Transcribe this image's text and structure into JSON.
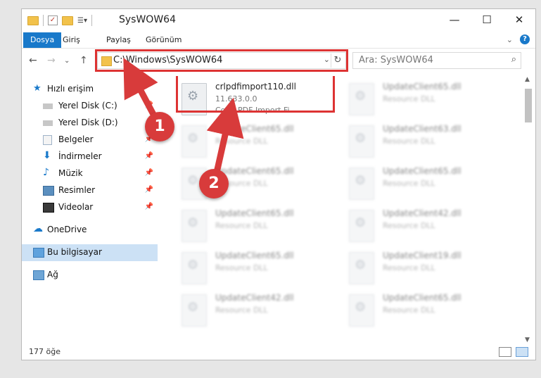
{
  "window": {
    "title": "SysWOW64"
  },
  "window_controls": {
    "minimize": "—",
    "maximize": "☐",
    "close": "✕"
  },
  "ribbon": {
    "tabs": [
      "Dosya",
      "Giriş",
      "Paylaş",
      "Görünüm"
    ],
    "help": "?"
  },
  "address": {
    "path": "C:\\Windows\\SysWOW64",
    "search_placeholder": "Ara: SysWOW64"
  },
  "sidebar": {
    "items": [
      {
        "label": "Hızlı erişim",
        "icon": "star-icon"
      },
      {
        "label": "Yerel Disk (C:)",
        "icon": "drive-icon"
      },
      {
        "label": "Yerel Disk (D:)",
        "icon": "drive-icon"
      },
      {
        "label": "Belgeler",
        "icon": "documents-icon"
      },
      {
        "label": "İndirmeler",
        "icon": "download-icon"
      },
      {
        "label": "Müzik",
        "icon": "music-icon"
      },
      {
        "label": "Resimler",
        "icon": "pictures-icon"
      },
      {
        "label": "Videolar",
        "icon": "videos-icon"
      },
      {
        "label": "OneDrive",
        "icon": "cloud-icon"
      },
      {
        "label": "Bu bilgisayar",
        "icon": "computer-icon"
      },
      {
        "label": "Ağ",
        "icon": "network-icon"
      }
    ]
  },
  "files": [
    {
      "name": "crlpdfimport110.dll",
      "version": "11.633.0.0",
      "desc": "Corel PDF Import Fi..."
    },
    {
      "name": "UpdateClient65.dll",
      "desc": "Resource DLL"
    },
    {
      "name": "UpdateClient65.dll",
      "desc": "Resource DLL"
    },
    {
      "name": "UpdateClient63.dll",
      "desc": "Resource DLL"
    },
    {
      "name": "UpdateClient65.dll",
      "desc": "Resource DLL"
    },
    {
      "name": "UpdateClient65.dll",
      "desc": "Resource DLL"
    },
    {
      "name": "UpdateClient65.dll",
      "desc": "Resource DLL"
    },
    {
      "name": "UpdateClient42.dll",
      "desc": "Resource DLL"
    },
    {
      "name": "UpdateClient65.dll",
      "desc": "Resource DLL"
    },
    {
      "name": "UpdateClient19.dll",
      "desc": "Resource DLL"
    },
    {
      "name": "UpdateClient42.dll",
      "desc": "Resource DLL"
    },
    {
      "name": "UpdateClient65.dll",
      "desc": "Resource DLL"
    }
  ],
  "status": {
    "count": "177 öğe"
  },
  "annotations": {
    "step1": "1",
    "step2": "2"
  },
  "colors": {
    "accent": "#1979ca",
    "highlight": "#d33333",
    "arrow": "#d83b3b"
  }
}
